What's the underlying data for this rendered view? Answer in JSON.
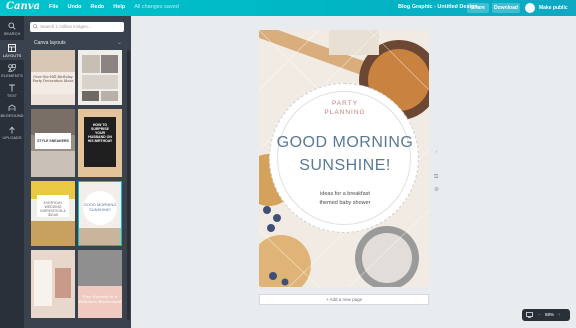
{
  "app": {
    "logo": "Canva",
    "menu": [
      "File",
      "Undo",
      "Redo",
      "Help"
    ],
    "save_status": "All changes saved",
    "document_title": "Blog Graphic - Untitled Design",
    "share_label": "Share",
    "download_label": "Download",
    "make_public_label": "Make public"
  },
  "rail": [
    {
      "label": "SEARCH",
      "icon": "search-icon"
    },
    {
      "label": "LAYOUTS",
      "icon": "layouts-icon"
    },
    {
      "label": "ELEMENTS",
      "icon": "elements-icon"
    },
    {
      "label": "TEXT",
      "icon": "text-icon"
    },
    {
      "label": "BKGROUND",
      "icon": "background-icon"
    },
    {
      "label": "UPLOADS",
      "icon": "uploads-icon"
    }
  ],
  "panel": {
    "search_placeholder": "Search 1 million images...",
    "title": "Canva layouts",
    "thumbs": [
      {
        "text": "Over-the-Hill Birthday Party Decoration Ideas"
      },
      {
        "text": ""
      },
      {
        "text": "STYLE SNEAKERS"
      },
      {
        "text": "HOW TO SURPRISE YOUR HUSBAND ON HIS BIRTHDAY"
      },
      {
        "text": "EVERYDAY WEDDING INSPIRATION & IDEAS"
      },
      {
        "text": "GOOD MORNING SUNSHINE!"
      },
      {
        "text": ""
      },
      {
        "text": "Five Secrets to a Fabulous Bridesmaid"
      }
    ]
  },
  "design": {
    "subtitle": "PARTY PLANNING",
    "title_line1": "GOOD MORNING",
    "title_line2": "SUNSHINE!",
    "desc_line1": "ideas for a breakfast",
    "desc_line2": "themed baby shower"
  },
  "canvas": {
    "add_page_label": "+ Add a new page",
    "zoom_label": "58%"
  },
  "colors": {
    "accent": "#00c4cc",
    "title_blue": "#5a7996",
    "subtitle_rose": "#c07f82"
  }
}
